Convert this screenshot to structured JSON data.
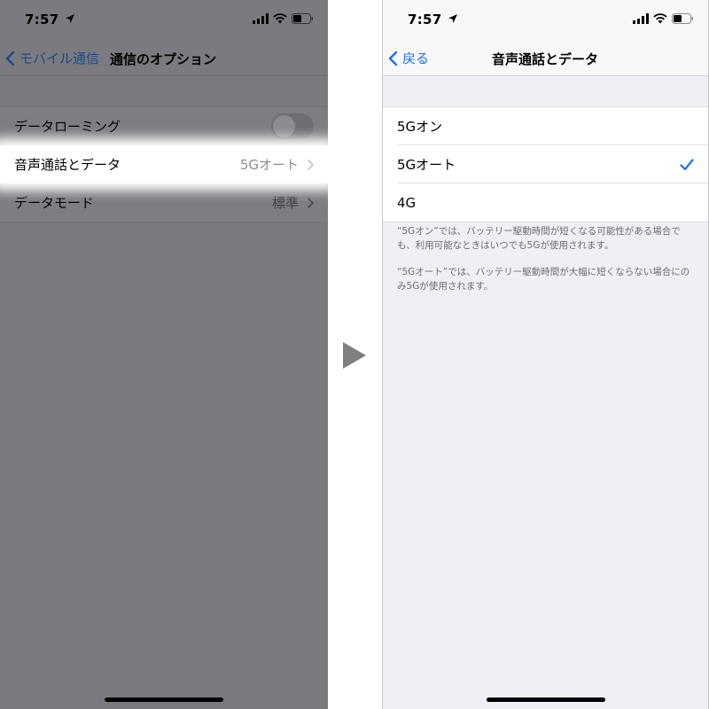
{
  "left": {
    "status": {
      "time": "7:57"
    },
    "nav": {
      "back_label": "モバイル通信",
      "title": "通信のオプション"
    },
    "rows": [
      {
        "label": "データローミング",
        "value": "",
        "toggle": "off"
      },
      {
        "label": "音声通話とデータ",
        "value": "5Gオート",
        "highlighted": true
      },
      {
        "label": "データモード",
        "value": "標準"
      }
    ]
  },
  "right": {
    "status": {
      "time": "7:57"
    },
    "nav": {
      "back_label": "戻る",
      "title": "音声通話とデータ"
    },
    "options": [
      {
        "label": "5Gオン",
        "selected": false
      },
      {
        "label": "5Gオート",
        "selected": true
      },
      {
        "label": "4G",
        "selected": false
      }
    ],
    "notes": [
      "“5Gオン”では、バッテリー駆動時間が短くなる可能性がある場合でも、利用可能なときはいつでも5Gが使用されます。",
      "“5Gオート”では、バッテリー駆動時間が大幅に短くならない場合にのみ5Gが使用されます。"
    ]
  },
  "colors": {
    "accent": "#1a73e8",
    "dimmed_accent": "#1a4a8a",
    "dim_background": "#7b7a80",
    "grouped_background": "#f0eff5",
    "highlight": "#ffffff"
  },
  "icons": [
    "location-arrow-icon",
    "cellular-signal-icon",
    "wifi-icon",
    "battery-icon",
    "back-chevron-icon",
    "disclosure-chevron-icon",
    "checkmark-icon",
    "play-arrow-icon"
  ]
}
